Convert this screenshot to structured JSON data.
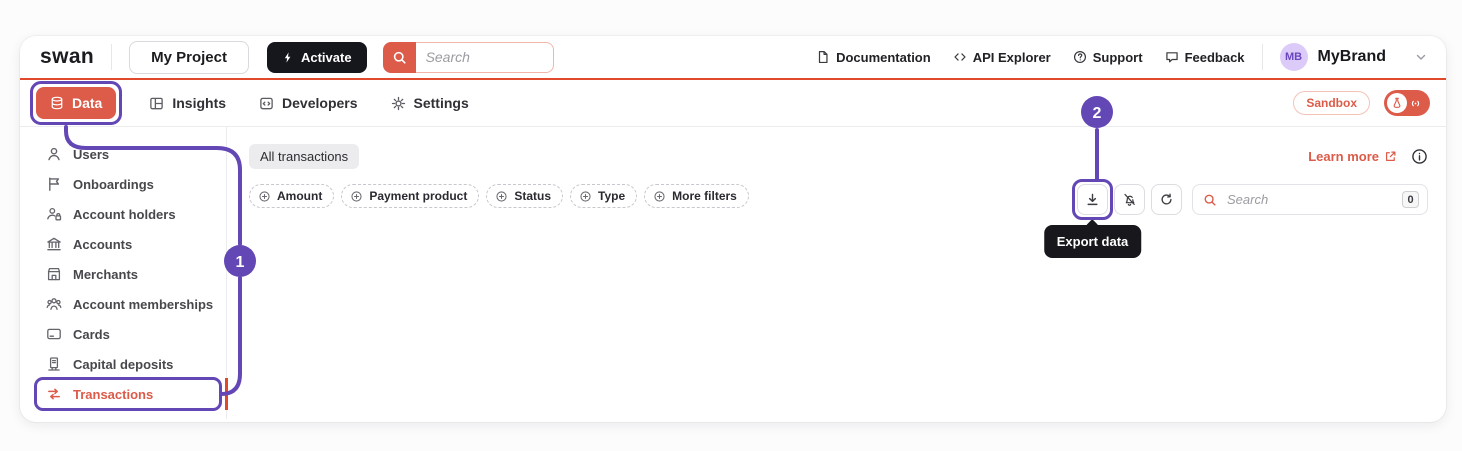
{
  "topbar": {
    "logo": "swan",
    "project_button": "My Project",
    "activate_button": "Activate",
    "search_placeholder": "Search",
    "links": [
      {
        "label": "Documentation",
        "icon": "document-icon"
      },
      {
        "label": "API Explorer",
        "icon": "code-icon"
      },
      {
        "label": "Support",
        "icon": "help-icon"
      },
      {
        "label": "Feedback",
        "icon": "chat-icon"
      }
    ],
    "account": {
      "initials": "MB",
      "name": "MyBrand"
    }
  },
  "nav": {
    "items": [
      {
        "label": "Data",
        "icon": "database-icon",
        "active": true
      },
      {
        "label": "Insights",
        "icon": "insights-icon",
        "active": false
      },
      {
        "label": "Developers",
        "icon": "developers-icon",
        "active": false
      },
      {
        "label": "Settings",
        "icon": "settings-icon",
        "active": false
      }
    ],
    "sandbox_badge": "Sandbox",
    "environment_toggle": {
      "icons": [
        "flask-icon",
        "live-signal-icon"
      ]
    }
  },
  "sidebar": {
    "items": [
      {
        "label": "Users",
        "icon": "user-icon",
        "active": false
      },
      {
        "label": "Onboardings",
        "icon": "flag-icon",
        "active": false
      },
      {
        "label": "Account holders",
        "icon": "user-lock-icon",
        "active": false
      },
      {
        "label": "Accounts",
        "icon": "bank-icon",
        "active": false
      },
      {
        "label": "Merchants",
        "icon": "store-icon",
        "active": false
      },
      {
        "label": "Account memberships",
        "icon": "group-icon",
        "active": false
      },
      {
        "label": "Cards",
        "icon": "card-icon",
        "active": false
      },
      {
        "label": "Capital deposits",
        "icon": "capital-deposit-icon",
        "active": false
      },
      {
        "label": "Transactions",
        "icon": "transactions-icon",
        "active": true
      }
    ]
  },
  "main": {
    "tab": "All transactions",
    "learn_more": "Learn more",
    "filters": [
      "Amount",
      "Payment product",
      "Status",
      "Type",
      "More filters"
    ],
    "toolbar_buttons": [
      "export-icon",
      "bell-off-icon",
      "refresh-icon"
    ],
    "search_placeholder": "Search",
    "search_shortcut": "0",
    "tooltip": "Export data"
  },
  "annotations": {
    "step1": "1",
    "step2": "2"
  },
  "colors": {
    "accent": "#dc5b49",
    "topbar_border": "#e1492c",
    "annotation_purple": "#6347b5",
    "dark_button": "#16161d",
    "tooltip_bg": "#17171c",
    "avatar_bg": "#dccbf8",
    "avatar_text": "#6a46c0"
  }
}
